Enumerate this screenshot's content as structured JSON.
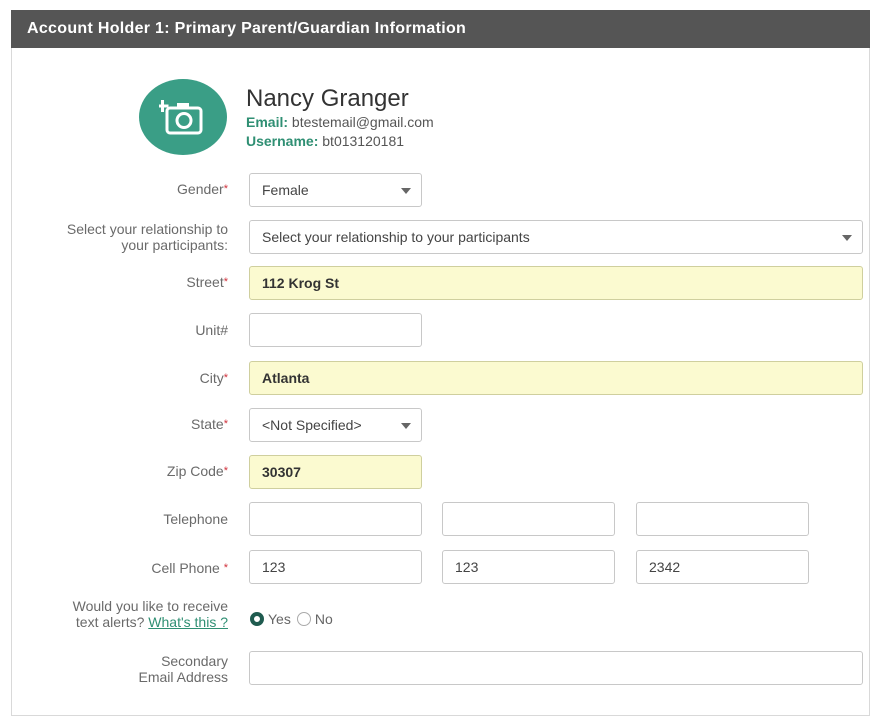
{
  "header": {
    "title": "Account Holder 1: Primary Parent/Guardian Information"
  },
  "colors": {
    "header_bg": "#555555",
    "accent": "#2f8f73",
    "avatar_bg": "#3a9e86",
    "required": "#d0303a",
    "filled_bg": "#fbfad0"
  },
  "profile": {
    "avatar_icon": "camera-add-icon",
    "name": "Nancy Granger",
    "email_key": "Email:",
    "email": "btestemail@gmail.com",
    "username_key": "Username:",
    "username": "bt013120181"
  },
  "form": {
    "required_mark": "*",
    "gender": {
      "label": "Gender",
      "value": "Female"
    },
    "relationship": {
      "label_line1": "Select your relationship to",
      "label_line2": "your participants:",
      "value": "Select your relationship to your participants"
    },
    "street": {
      "label": "Street",
      "value": "112 Krog St"
    },
    "unit": {
      "label": "Unit#",
      "value": ""
    },
    "city": {
      "label": "City",
      "value": "Atlanta"
    },
    "state": {
      "label": "State",
      "value": "<Not Specified>"
    },
    "zip": {
      "label": "Zip Code",
      "value": "30307"
    },
    "telephone": {
      "label": "Telephone",
      "part1": "",
      "part2": "",
      "part3": ""
    },
    "cell": {
      "label": "Cell Phone ",
      "part1": "123",
      "part2": "123",
      "part3": "2342"
    },
    "text_alerts": {
      "label_line1": "Would you like to receive",
      "label_line2_prefix": "text alerts?",
      "link": "What's this ?",
      "yes": "Yes",
      "no": "No",
      "selected": "Yes"
    },
    "secondary_email": {
      "label_line1": "Secondary",
      "label_line2": "Email Address",
      "value": ""
    }
  }
}
